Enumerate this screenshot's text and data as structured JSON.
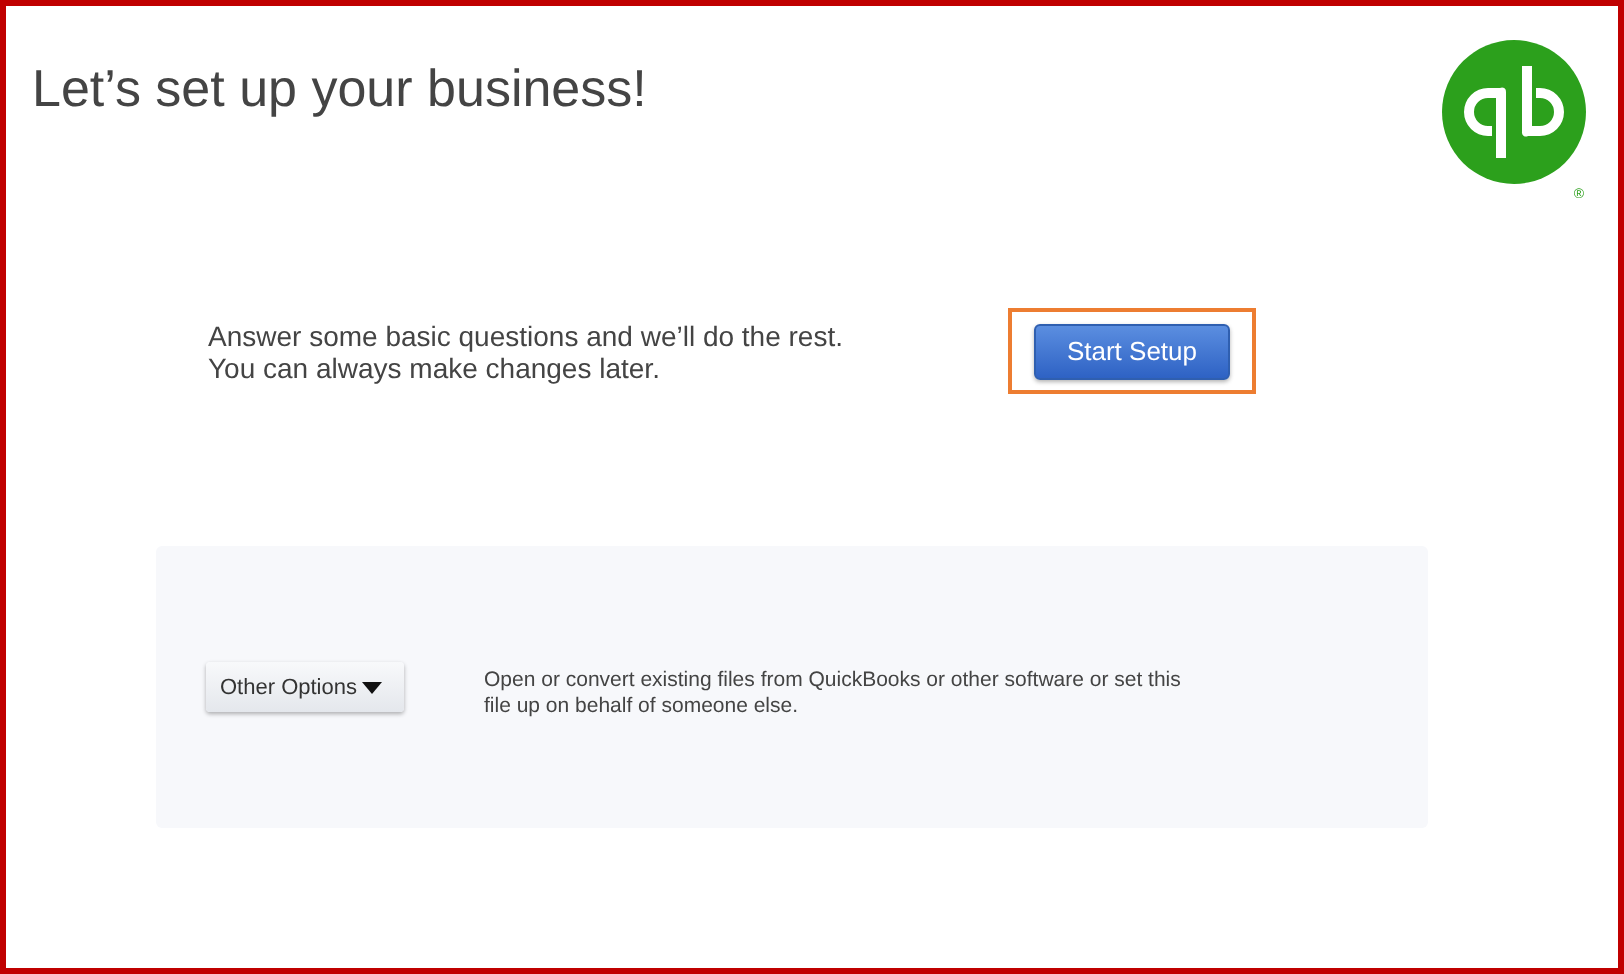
{
  "title": "Let’s set up your business!",
  "logo": {
    "trademark": "®"
  },
  "intro": {
    "lines": [
      "Answer some basic questions and we’ll do the rest.",
      "You can always make changes later."
    ],
    "button": "Start Setup",
    "highlighted": true
  },
  "other": {
    "button": "Other Options",
    "description": "Open or convert existing files from QuickBooks or other software or set this file up on behalf of someone else."
  }
}
